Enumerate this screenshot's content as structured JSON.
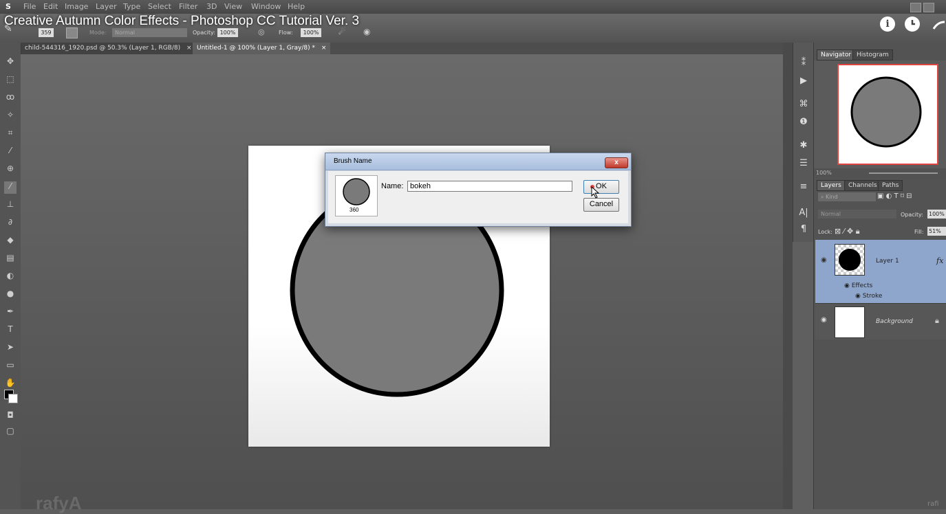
{
  "video": {
    "title": "Creative Autumn Color Effects - Photoshop CC Tutorial Ver. 3"
  },
  "menubar": {
    "app_glyph": "S",
    "items": [
      "File",
      "Edit",
      "Image",
      "Layer",
      "Type",
      "Select",
      "Filter",
      "3D",
      "View",
      "Window",
      "Help"
    ]
  },
  "options": {
    "brush_size": "359",
    "mode_label": "Mode:",
    "mode_value": "Normal",
    "opacity_label": "Opacity:",
    "opacity_value": "100%",
    "flow_label": "Flow:",
    "flow_value": "100%"
  },
  "tabs": [
    {
      "label": "child-544316_1920.psd @ 50.3% (Layer 1, RGB/8)",
      "close": "×"
    },
    {
      "label": "Untitled-1 @ 100% (Layer 1, Gray/8) *",
      "close": "×"
    }
  ],
  "dialog": {
    "title": "Brush Name",
    "name_label": "Name:",
    "name_value": "bokeh",
    "preview_size": "360",
    "ok_label": "OK",
    "cancel_label": "Cancel",
    "close_glyph": "x"
  },
  "panels": {
    "top_tabs": [
      "Navigator",
      "Histogram"
    ],
    "zoom": "100%",
    "layer_tabs": [
      "Layers",
      "Channels",
      "Paths"
    ],
    "filter_kind": "Kind",
    "blend_mode": "Normal",
    "opacity_label": "Opacity:",
    "opacity_value": "100%",
    "lock_label": "Lock:",
    "fill_label": "Fill:",
    "fill_value": "51%",
    "layers": [
      {
        "name": "Layer 1",
        "fx": "fx"
      },
      {
        "name": "Background"
      }
    ],
    "effects_label": "Effects",
    "stroke_label": "Stroke"
  },
  "watermark": {
    "text": "rafyA",
    "corner": "rafi"
  },
  "colors": {
    "accent_red": "#e0443e",
    "selection_blue": "#8fa6cc",
    "dialog_frame": "#a8bedd"
  }
}
